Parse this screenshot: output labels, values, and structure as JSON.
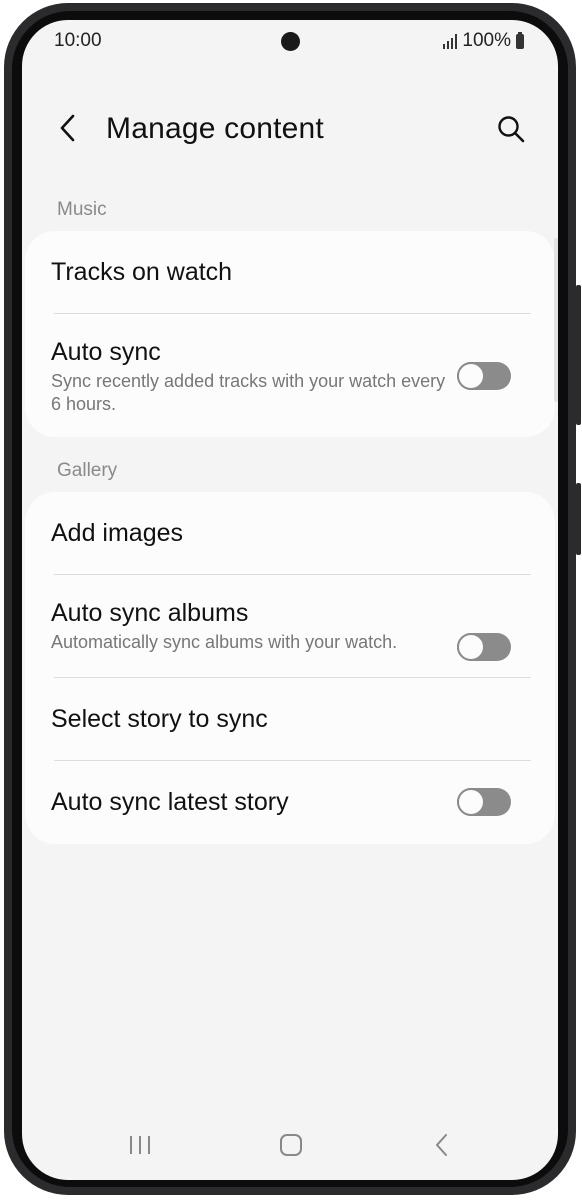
{
  "status_bar": {
    "time": "10:00",
    "battery_text": "100%",
    "icons": [
      "signal-icon",
      "battery-icon"
    ]
  },
  "app_bar": {
    "title": "Manage content",
    "icons": [
      "back-arrow-icon",
      "search-icon"
    ]
  },
  "sections": [
    {
      "label": "Music",
      "items": [
        {
          "title": "Tracks on watch"
        },
        {
          "title": "Auto sync",
          "subtitle": "Sync recently added tracks with your watch every 6 hours.",
          "toggle": false
        }
      ]
    },
    {
      "label": "Gallery",
      "items": [
        {
          "title": "Add images"
        },
        {
          "title": "Auto sync albums",
          "subtitle": "Automatically sync albums with your watch.",
          "toggle": false
        },
        {
          "title": "Select story to sync"
        },
        {
          "title": "Auto sync latest story",
          "toggle": false
        }
      ]
    }
  ],
  "nav_bar": {
    "icons": [
      "recents-icon",
      "home-icon",
      "back-icon"
    ]
  },
  "colors": {
    "background": "#f4f4f4",
    "card": "#fcfcfc",
    "toggle_off": "#8b8b8b",
    "section_label": "#8a8a8a"
  }
}
